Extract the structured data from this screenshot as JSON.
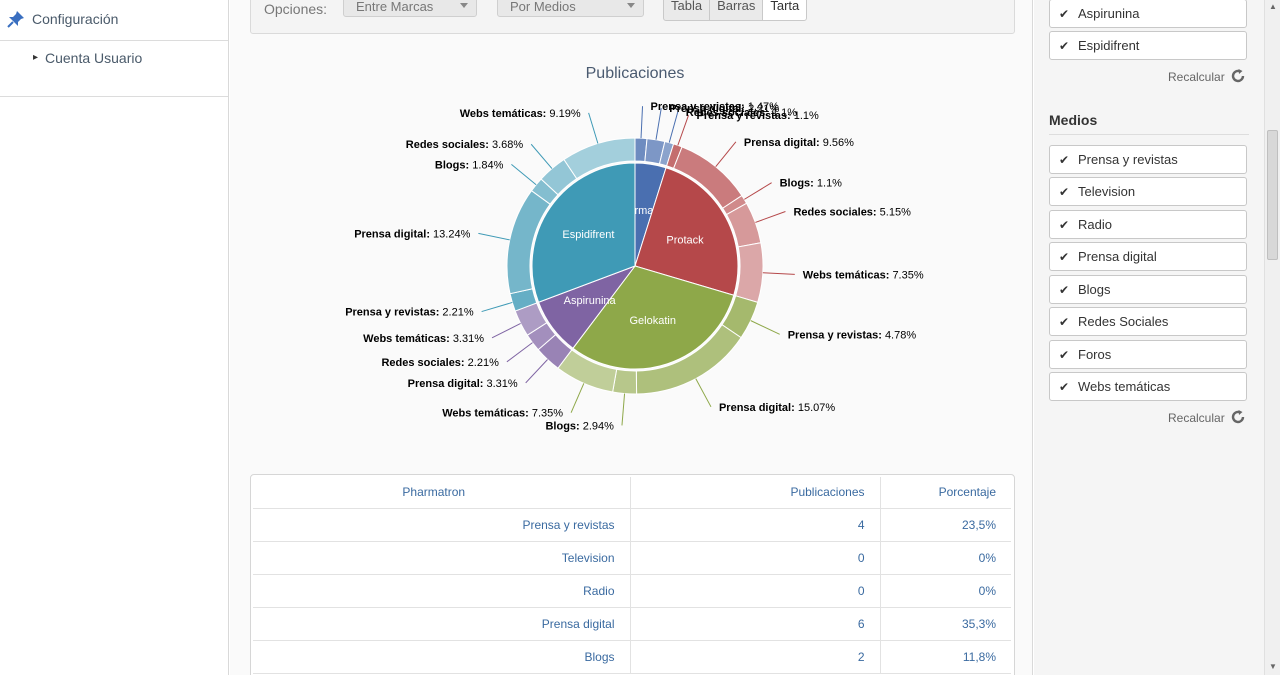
{
  "sidebar": {
    "config_label": "Configuración",
    "sub_item": "Cuenta Usuario",
    "pin_icon": "pushpin-icon"
  },
  "options": {
    "label": "Opciones:",
    "dropdown1": "Entre Marcas",
    "dropdown2": "Por Medios",
    "views": [
      "Tabla",
      "Barras",
      "Tarta"
    ],
    "active_view": "Tarta"
  },
  "chart_data": {
    "type": "pie",
    "title": "Publicaciones",
    "inner": [
      {
        "name": "Pharmatron",
        "color": "#4a6fb0"
      },
      {
        "name": "Protack",
        "color": "#b5484a"
      },
      {
        "name": "Gelokatin",
        "color": "#8ea849"
      },
      {
        "name": "Aspirunina",
        "color": "#7f64a3"
      },
      {
        "name": "Espidifrent",
        "color": "#3f9ab6"
      }
    ],
    "outer": [
      {
        "brand": "Pharmatron",
        "label": "Prensa y revistas",
        "value": 1.47
      },
      {
        "brand": "Pharmatron",
        "label": "Prensa digital",
        "value": 2.21
      },
      {
        "brand": "Pharmatron",
        "label": "Redes sociales",
        "value": 1.1
      },
      {
        "brand": "Protack",
        "label": "Prensa y revistas",
        "value": 1.1
      },
      {
        "brand": "Protack",
        "label": "Prensa digital",
        "value": 9.56
      },
      {
        "brand": "Protack",
        "label": "Blogs",
        "value": 1.1
      },
      {
        "brand": "Protack",
        "label": "Redes sociales",
        "value": 5.15
      },
      {
        "brand": "Protack",
        "label": "Webs temáticas",
        "value": 7.35
      },
      {
        "brand": "Gelokatin",
        "label": "Prensa y revistas",
        "value": 4.78
      },
      {
        "brand": "Gelokatin",
        "label": "Prensa digital",
        "value": 15.07
      },
      {
        "brand": "Gelokatin",
        "label": "Blogs",
        "value": 2.94
      },
      {
        "brand": "Gelokatin",
        "label": "Webs temáticas",
        "value": 7.35
      },
      {
        "brand": "Aspirunina",
        "label": "Prensa digital",
        "value": 3.31
      },
      {
        "brand": "Aspirunina",
        "label": "Redes sociales",
        "value": 2.21
      },
      {
        "brand": "Aspirunina",
        "label": "Webs temáticas",
        "value": 3.31
      },
      {
        "brand": "Espidifrent",
        "label": "Prensa y revistas",
        "value": 2.21
      },
      {
        "brand": "Espidifrent",
        "label": "Prensa digital",
        "value": 13.24
      },
      {
        "brand": "Espidifrent",
        "label": "Blogs",
        "value": 1.84
      },
      {
        "brand": "Espidifrent",
        "label": "Redes sociales",
        "value": 3.68
      },
      {
        "brand": "Espidifrent",
        "label": "Webs temáticas",
        "value": 9.19
      }
    ]
  },
  "table": {
    "headers": [
      "Pharmatron",
      "Publicaciones",
      "Porcentaje"
    ],
    "rows": [
      [
        "Prensa y revistas",
        "4",
        "23,5%"
      ],
      [
        "Television",
        "0",
        "0%"
      ],
      [
        "Radio",
        "0",
        "0%"
      ],
      [
        "Prensa digital",
        "6",
        "35,3%"
      ],
      [
        "Blogs",
        "2",
        "11,8%"
      ]
    ]
  },
  "right": {
    "brands": [
      "Aspirunina",
      "Espidifrent"
    ],
    "recalc_label": "Recalcular",
    "medios_title": "Medios",
    "medios": [
      "Prensa y revistas",
      "Television",
      "Radio",
      "Prensa digital",
      "Blogs",
      "Redes Sociales",
      "Foros",
      "Webs temáticas"
    ]
  }
}
